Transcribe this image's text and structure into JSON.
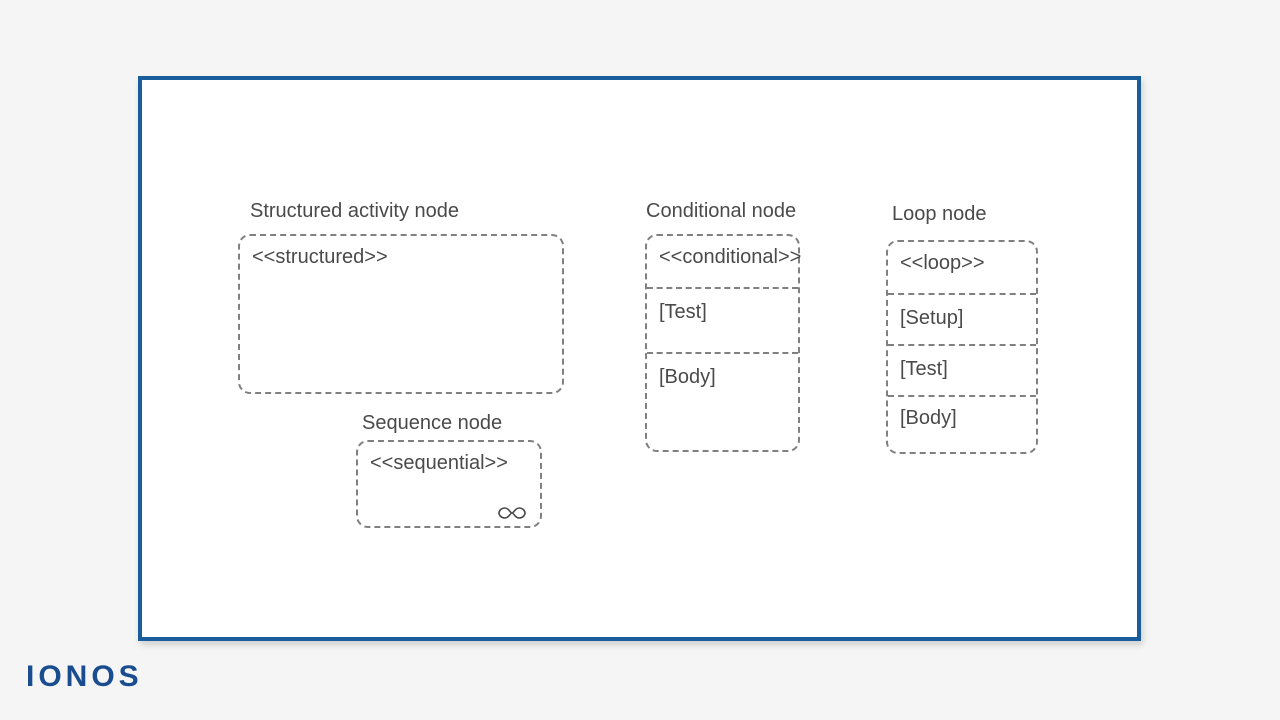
{
  "structured": {
    "title": "Structured activity node",
    "stereotype": "<<structured>>"
  },
  "sequence": {
    "title": "Sequence node",
    "stereotype": "<<sequential>>"
  },
  "conditional": {
    "title": "Conditional node",
    "stereotype": "<<conditional>>",
    "compartments": [
      "[Test]",
      "[Body]"
    ]
  },
  "loop": {
    "title": "Loop node",
    "stereotype": "<<loop>>",
    "compartments": [
      "[Setup]",
      "[Test]",
      "[Body]"
    ]
  },
  "brand": "IONOS"
}
